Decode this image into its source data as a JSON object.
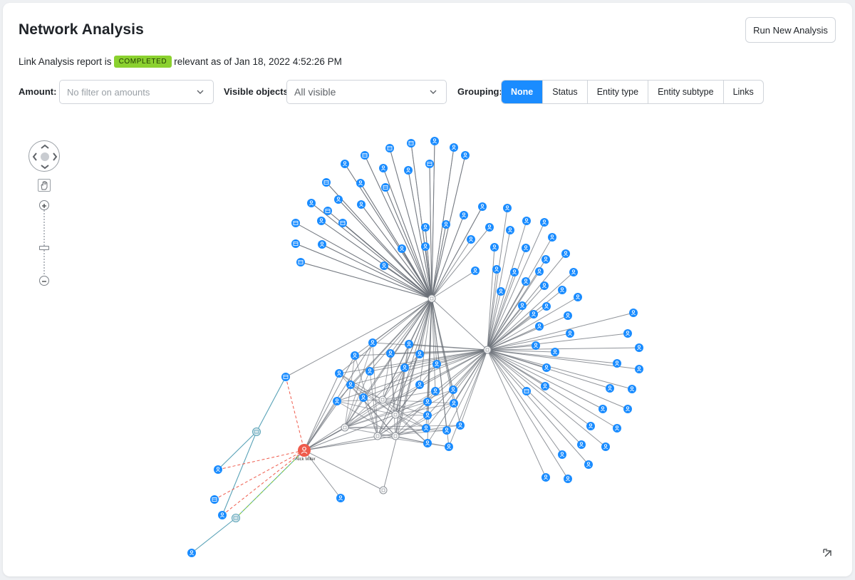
{
  "header": {
    "title": "Network Analysis",
    "run_button": "Run New Analysis"
  },
  "status": {
    "prefix": "Link Analysis report is",
    "badge": "COMPLETED",
    "suffix": "relevant as of Jan 18, 2022 4:52:26 PM",
    "badge_color": "#8bd12f"
  },
  "filters": {
    "amount_label": "Amount:",
    "amount_placeholder": "No filter on amounts",
    "visible_label": "Visible objects:",
    "visible_value": "All visible",
    "grouping_label": "Grouping:",
    "grouping_options": [
      "None",
      "Status",
      "Entity type",
      "Entity subtype",
      "Links"
    ],
    "grouping_selected": "None"
  },
  "graph": {
    "focus_node_label": "Nick Miller",
    "colors": {
      "node": "#1a8cff",
      "focus": "#ef5b4c",
      "hub": "#ffffff",
      "edge": "#6b7078",
      "teal_edge": "#5aa3b8",
      "red_dash": "#ef5b4c",
      "green_dash": "#8bd12f"
    },
    "icons": [
      "person-icon",
      "building-icon",
      "document-icon",
      "home-icon",
      "hub-icon"
    ]
  },
  "controls": {
    "icons": [
      "pan-arrows-icon",
      "hand-icon",
      "zoom-in-icon",
      "zoom-out-icon",
      "expand-icon"
    ]
  }
}
